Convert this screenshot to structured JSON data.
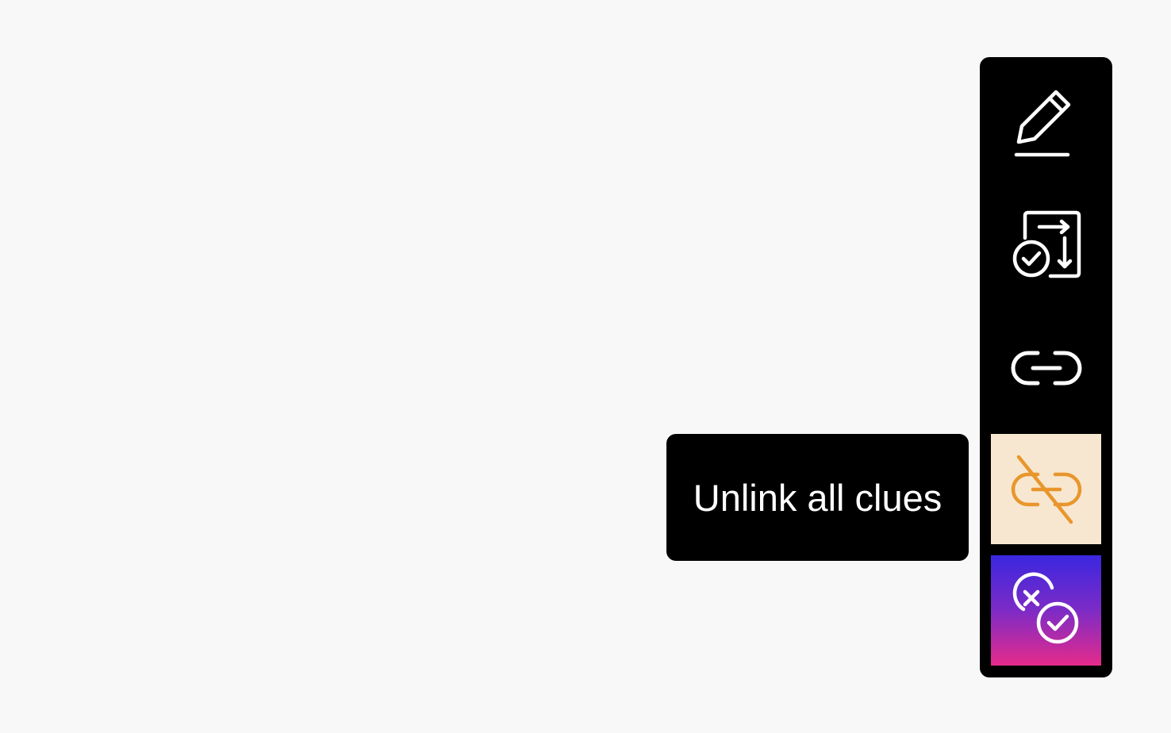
{
  "toolbar": {
    "items": [
      {
        "id": "edit",
        "icon": "pencil-edit-icon"
      },
      {
        "id": "reorder",
        "icon": "document-reorder-check-icon"
      },
      {
        "id": "link",
        "icon": "link-icon"
      },
      {
        "id": "unlink",
        "icon": "unlink-icon",
        "state": "hovered"
      },
      {
        "id": "resolve",
        "icon": "cross-check-circles-icon"
      }
    ]
  },
  "tooltip": {
    "text": "Unlink all clues"
  },
  "colors": {
    "background": "#f8f8f8",
    "toolbar": "#000000",
    "icon": "#ffffff",
    "unlink_background": "#f8e7d0",
    "unlink_icon": "#e8962c",
    "resolve_gradient_top": "#3a27e0",
    "resolve_gradient_bottom": "#e62b8a"
  }
}
